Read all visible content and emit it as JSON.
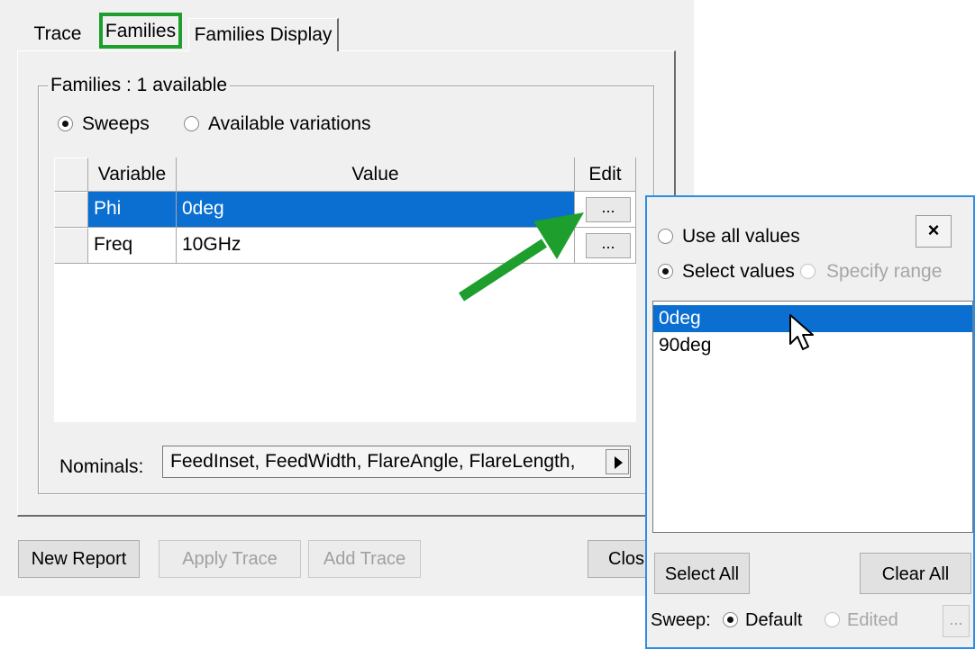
{
  "tabs": [
    "Trace",
    "Families",
    "Families Display"
  ],
  "families_group": {
    "title": "Families : 1 available",
    "radio_sweeps": "Sweeps",
    "radio_variations": "Available variations"
  },
  "grid": {
    "headers": [
      "Variable",
      "Value",
      "Edit"
    ],
    "rows": [
      {
        "variable": "Phi",
        "value": "0deg",
        "edit": "..."
      },
      {
        "variable": "Freq",
        "value": "10GHz",
        "edit": "..."
      }
    ]
  },
  "nominals": {
    "label": "Nominals:",
    "value": "FeedInset, FeedWidth, FlareAngle, FlareLength, "
  },
  "buttons": {
    "new_report": "New Report",
    "apply_trace": "Apply Trace",
    "add_trace": "Add Trace",
    "close": "Clos"
  },
  "popup": {
    "use_all": "Use all values",
    "select_values": "Select values",
    "specify_range": "Specify range",
    "close_symbol": "×",
    "values": [
      "0deg",
      "90deg"
    ],
    "select_all": "Select All",
    "clear_all": "Clear All",
    "sweep_label": "Sweep:",
    "sweep_default": "Default",
    "sweep_edited": "Edited",
    "sweep_edit_btn": "..."
  },
  "colors": {
    "selection": "#0a6fd1",
    "highlight_annotation": "#1e9f2d",
    "popup_border": "#2e8ee6"
  },
  "icons": [
    "radio-icon",
    "close-icon",
    "right-arrow-icon",
    "cursor-icon",
    "annotation-arrow-icon"
  ]
}
